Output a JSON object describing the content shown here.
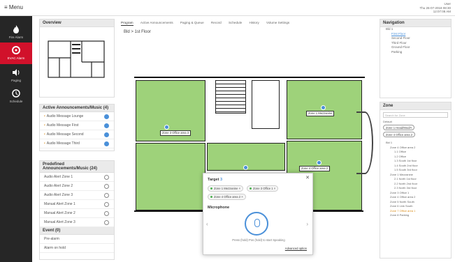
{
  "menu_label": "≡ Menu",
  "topright": [
    "User",
    "Thu 26-07-2018 08:30",
    "12:07:08 AM"
  ],
  "leftnav": [
    {
      "label": "Fire Alarm",
      "icon": "flame-icon"
    },
    {
      "label": "EVAC Alarm",
      "icon": "alarm-bell-icon"
    },
    {
      "label": "Paging",
      "icon": "speaker-icon"
    },
    {
      "label": "Schedule",
      "icon": "clock-icon"
    }
  ],
  "overview": {
    "title": "Overview"
  },
  "active_announcements": {
    "title": "Active Announcements/Music (4)",
    "items": [
      "Audio Message Lounge",
      "Audio Message First",
      "Audio Message Second",
      "Audio Message Third"
    ]
  },
  "predefined": {
    "title": "Predefined Announcements/Music (24)",
    "items": [
      "Audio Alert Zone 1",
      "Audio Alert Zone 2",
      "Audio Alert Zone 3",
      "Manual Alert Zone 1",
      "Manual Alert Zone 2",
      "Manual Alert Zone 3"
    ]
  },
  "events": {
    "title": "Event (0)",
    "items": [
      "Pre-alarm",
      "Alarm on hold"
    ]
  },
  "tabs": [
    "Program",
    "Active Announcements",
    "Paging & Queue",
    "Record",
    "Schedule",
    "History",
    "Volume Settings"
  ],
  "active_tab": 0,
  "breadcrumb": "Bld > 1st Floor",
  "zone_labels": [
    "Zone 3 Office area 3",
    "Zone 1 Mezzanine",
    "Zone 4 Office area 2"
  ],
  "popup": {
    "target_label": "Target",
    "target_count": "3",
    "chips": [
      "Zone 1 Mezzanine ×",
      "Zone 3 Office 1 ×",
      "Zone 4 Office area 2 ×"
    ],
    "microphone_label": "Microphone",
    "instruction": "Press (hold) Pos (hold) to start Speaking",
    "advanced_link": "Advanced option"
  },
  "navigation": {
    "title": "Navigation",
    "root": "Bld 1",
    "items": [
      "First Floor",
      "Second Floor",
      "Third Floor",
      "Ground Floor",
      "Parking"
    ]
  },
  "zone_panel": {
    "title": "Zone",
    "search_placeholder": "Search for Zone",
    "default_label": "Default",
    "buttons": [
      "Zone 1 Head/Mod/A",
      "Zone 4 Office area 2"
    ],
    "tree": [
      "Bld 1",
      "Zone 4 Office area 2",
      "1.1 Office",
      "1.2 Office",
      "1.3 South 1st floor",
      "1.4 South 2nd floor",
      "1.5 South 3rd floor",
      "Zone 1 Mezzanine",
      "2.1 North 1st floor",
      "2.2 North 2nd floor",
      "2.3 North 3rd floor",
      "Zone 3 Office 1",
      "Zone 4 Office area 2",
      "Zone 5 North South",
      "Zone 6 Link South",
      "Zone 7 Office area 1",
      "Zone 8 Parking"
    ]
  },
  "colors": {
    "accent": "#d1112b",
    "zone_green": "#9ed27a",
    "link_blue": "#4a90d9"
  }
}
